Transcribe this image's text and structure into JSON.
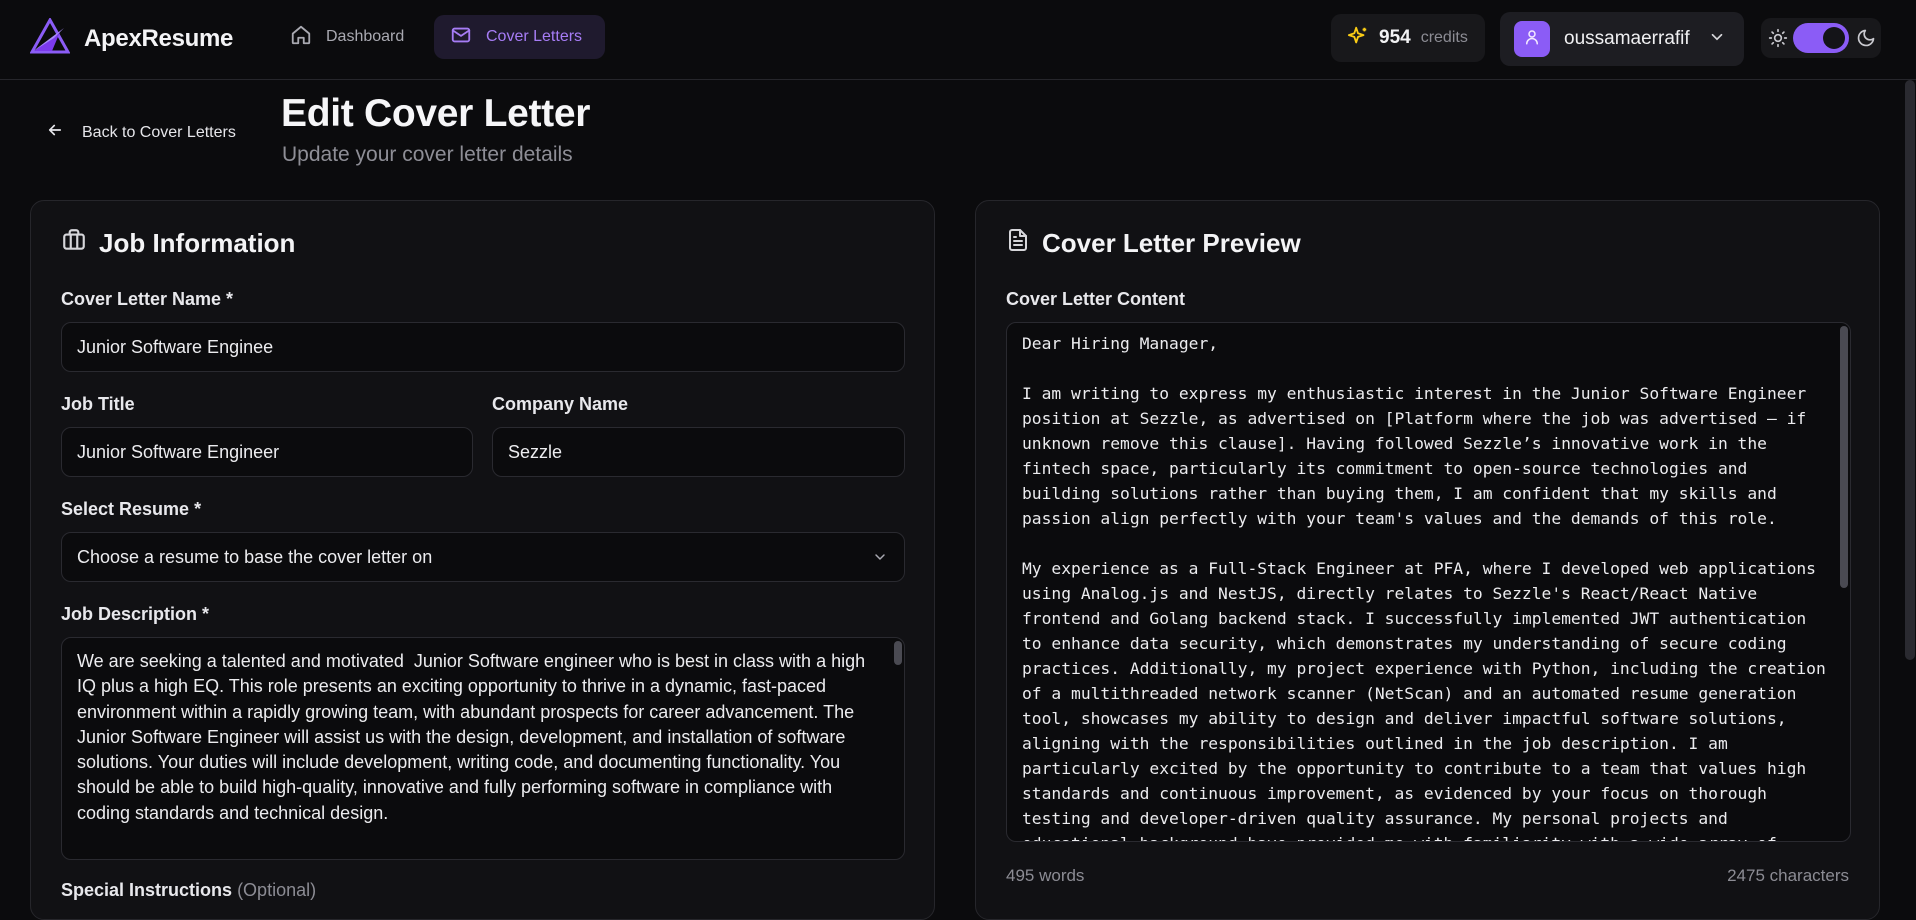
{
  "app": {
    "name": "ApexResume"
  },
  "nav": [
    {
      "label": "Dashboard",
      "icon": "home-icon",
      "active": false
    },
    {
      "label": "Cover Letters",
      "icon": "mail-icon",
      "active": true
    }
  ],
  "credits": {
    "value": "954",
    "label": "credits",
    "icon": "sparkles-icon"
  },
  "user": {
    "name": "oussamaerrafif"
  },
  "theme": {
    "mode": "dark",
    "accent": "#8b5cf6"
  },
  "page": {
    "back_label": "Back to Cover Letters",
    "title": "Edit Cover Letter",
    "subtitle": "Update your cover letter details"
  },
  "job_info": {
    "title": "Job Information",
    "cover_letter_name": {
      "label": "Cover Letter Name *",
      "value": "Junior Software Enginee"
    },
    "job_title": {
      "label": "Job Title",
      "value": "Junior Software Engineer"
    },
    "company_name": {
      "label": "Company Name",
      "value": "Sezzle"
    },
    "select_resume": {
      "label": "Select Resume *",
      "value": "Choose a resume to base the cover letter on"
    },
    "job_description": {
      "label": "Job Description *",
      "value": "We are seeking a talented and motivated  Junior Software engineer who is best in class with a high IQ plus a high EQ. This role presents an exciting opportunity to thrive in a dynamic, fast-paced environment within a rapidly growing team, with abundant prospects for career advancement. The Junior Software Engineer will assist us with the design, development, and installation of software solutions. Your duties will include development, writing code, and documenting functionality. You should be able to build high-quality, innovative and fully performing software in compliance with coding standards and technical design."
    },
    "special_instructions": {
      "label": "Special Instructions",
      "optional": "(Optional)"
    }
  },
  "preview": {
    "title": "Cover Letter Preview",
    "content_label": "Cover Letter Content",
    "content": "Dear Hiring Manager,\n\nI am writing to express my enthusiastic interest in the Junior Software Engineer position at Sezzle, as advertised on [Platform where the job was advertised – if unknown remove this clause]. Having followed Sezzle’s innovative work in the fintech space, particularly its commitment to open-source technologies and building solutions rather than buying them, I am confident that my skills and passion align perfectly with your team's values and the demands of this role.\n\nMy experience as a Full-Stack Engineer at PFA, where I developed web applications using Analog.js and NestJS, directly relates to Sezzle's React/React Native frontend and Golang backend stack. I successfully implemented JWT authentication to enhance data security, which demonstrates my understanding of secure coding practices. Additionally, my project experience with Python, including the creation of a multithreaded network scanner (NetScan) and an automated resume generation tool, showcases my ability to design and deliver impactful software solutions, aligning with the responsibilities outlined in the job description. I am particularly excited by the opportunity to contribute to a team that values high standards and continuous improvement, as evidenced by your focus on thorough testing and developer-driven quality assurance. My personal projects and educational background have provided me with familiarity with a wide array of tools",
    "words": "495 words",
    "characters": "2475 characters"
  }
}
